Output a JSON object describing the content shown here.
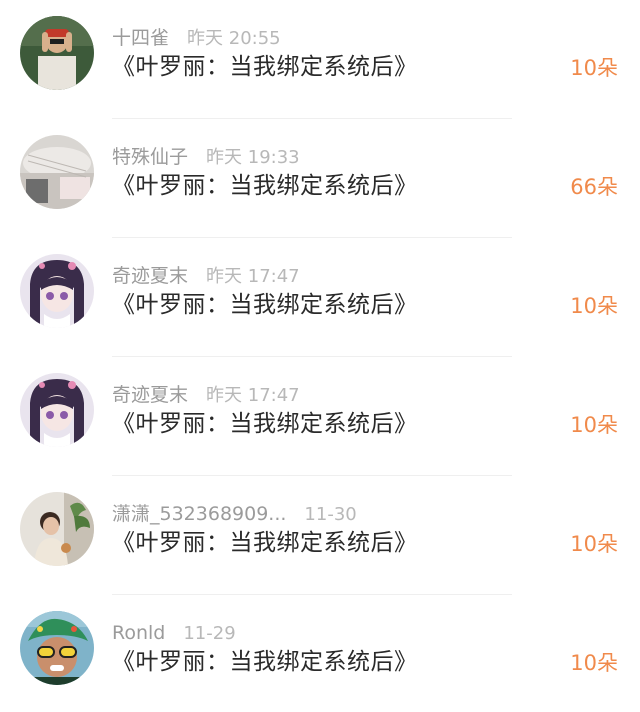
{
  "items": [
    {
      "name": "十四雀",
      "time": "昨天 20:55",
      "title": "《叶罗丽：当我绑定系统后》",
      "count": "10朵"
    },
    {
      "name": "特殊仙子",
      "time": "昨天 19:33",
      "title": "《叶罗丽：当我绑定系统后》",
      "count": "66朵"
    },
    {
      "name": "奇迹夏末",
      "time": "昨天 17:47",
      "title": "《叶罗丽：当我绑定系统后》",
      "count": "10朵"
    },
    {
      "name": "奇迹夏末",
      "time": "昨天 17:47",
      "title": "《叶罗丽：当我绑定系统后》",
      "count": "10朵"
    },
    {
      "name": "潇潇_532368909...",
      "time": "11-30",
      "title": "《叶罗丽：当我绑定系统后》",
      "count": "10朵"
    },
    {
      "name": "Ronld",
      "time": "11-29",
      "title": "《叶罗丽：当我绑定系统后》",
      "count": "10朵"
    }
  ],
  "colors": {
    "accent": "#f08a4b",
    "name": "#9b9b9b",
    "time": "#b8b8b8",
    "title": "#2a2a2a"
  }
}
